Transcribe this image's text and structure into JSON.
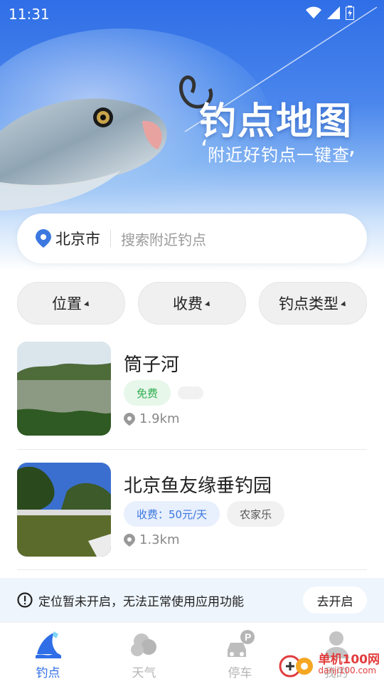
{
  "status_bar": {
    "time": "11:31"
  },
  "hero": {
    "title": "钓点地图",
    "subtitle": "附近好钓点一键查"
  },
  "search": {
    "city": "北京市",
    "placeholder": "搜索附近钓点"
  },
  "filters": [
    {
      "label": "位置"
    },
    {
      "label": "收费"
    },
    {
      "label": "钓点类型"
    }
  ],
  "spots": [
    {
      "name": "筒子河",
      "tags": [
        "免费",
        ""
      ],
      "distance": "1.9km"
    },
    {
      "name": "北京鱼友缘垂钓园",
      "tags": [
        "收费：50元/天",
        "农家乐"
      ],
      "distance": "1.3km"
    }
  ],
  "notice": {
    "text": "定位暂未开启，无法正常使用应用功能",
    "button": "去开启"
  },
  "nav": [
    {
      "label": "钓点",
      "icon": "fishing-spot-icon",
      "active": true
    },
    {
      "label": "天气",
      "icon": "weather-cloud-icon",
      "active": false
    },
    {
      "label": "停车",
      "icon": "parking-car-icon",
      "active": false
    },
    {
      "label": "我的",
      "icon": "user-profile-icon",
      "active": false
    }
  ],
  "watermark": {
    "text": "单机100网",
    "sub": "danji100.com"
  },
  "colors": {
    "accent": "#2f6ee6",
    "free_tag": "#2fae4f",
    "paid_tag": "#3c78e0"
  }
}
